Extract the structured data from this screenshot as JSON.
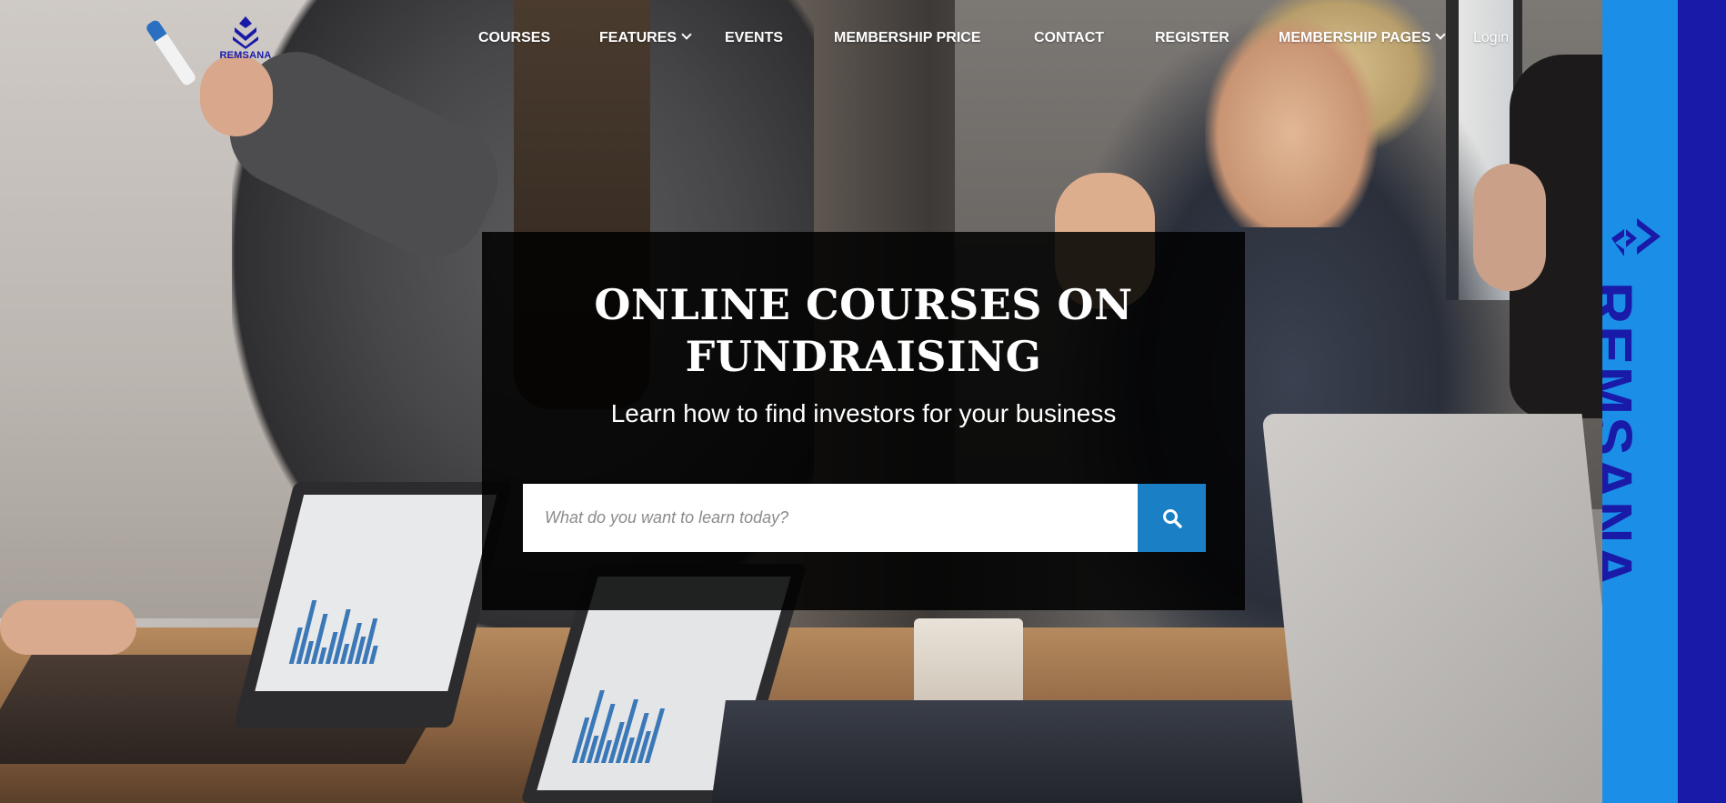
{
  "brand": {
    "logo_text": "REMSANA",
    "banner_text": "REMSANA",
    "logo_color": "#1a1aa8",
    "banner_color": "#1b8fe8"
  },
  "nav": {
    "items": [
      {
        "label": "COURSES"
      },
      {
        "label": "FEATURES",
        "dropdown": true
      },
      {
        "label": "EVENTS"
      },
      {
        "label": "MEMBERSHIP PRICE"
      },
      {
        "label": "CONTACT"
      },
      {
        "label": "REGISTER"
      },
      {
        "label": "MEMBERSHIP PAGES",
        "dropdown": true
      }
    ],
    "login_label": "Login"
  },
  "hero": {
    "title_line1": "ONLINE COURSES ON",
    "title_line2": "FUNDRAISING",
    "subtitle": "Learn how to find investors for your business",
    "search_placeholder": "What do you want to learn today?",
    "search_value": "",
    "search_button_icon": "search-icon",
    "accent_color": "#1a7fc4"
  }
}
